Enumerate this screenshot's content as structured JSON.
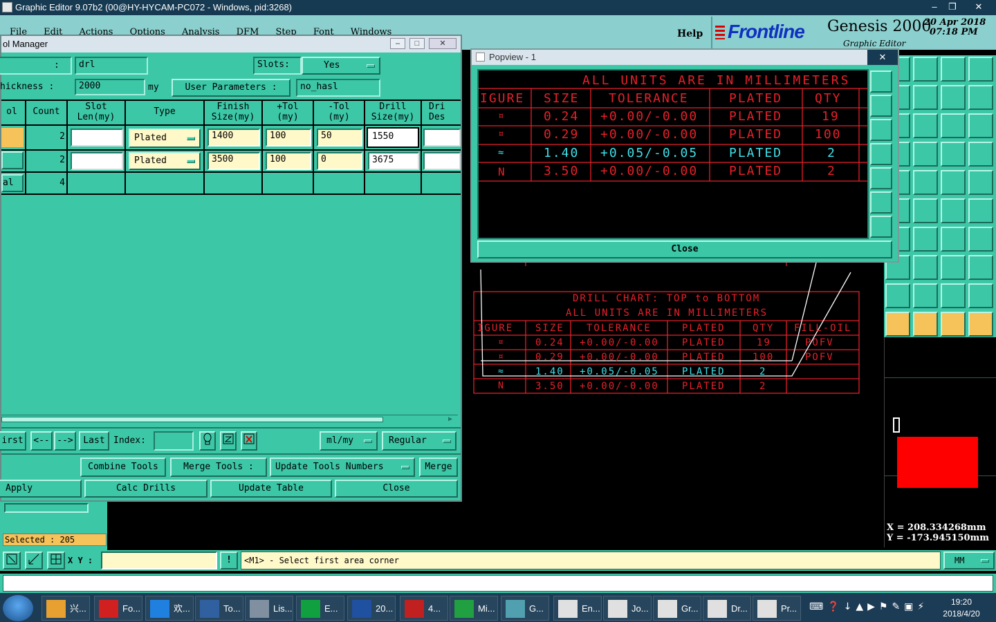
{
  "window": {
    "title": "Graphic Editor 9.07b2 (00@HY-HYCAM-PC072 - Windows, pid:3268)",
    "min": "–",
    "max": "❐",
    "close": "✕"
  },
  "menu": [
    "File",
    "Edit",
    "Actions",
    "Options",
    "Analysis",
    "DFM",
    "Step",
    "Font",
    "Windows"
  ],
  "help": "Help",
  "brand": {
    "logo": "Frontline",
    "product": "Genesis 2000",
    "subtitle": "Graphic Editor",
    "date": "20 Apr 2018",
    "time": "07:18 PM"
  },
  "tool_manager": {
    "title": "ol Manager",
    "colon": ":",
    "layer": "drl",
    "slots_label": "Slots:",
    "slots_value": "Yes",
    "thickness_label": "hickness :",
    "thickness_value": "2000",
    "thickness_unit": "my",
    "user_params_label": "User Parameters :",
    "user_params_value": "no_hasl",
    "columns": [
      "ol",
      "Count",
      "Slot\nLen(my)",
      "Type",
      "Finish\nSize(my)",
      "+Tol\n(my)",
      "-Tol\n(my)",
      "Drill\nSize(my)",
      "Dri\nDes"
    ],
    "rows": [
      {
        "count": "2",
        "type": "Plated",
        "finish": "1400",
        "ptol": "100",
        "ntol": "50",
        "drill": "1550"
      },
      {
        "count": "2",
        "type": "Plated",
        "finish": "3500",
        "ptol": "100",
        "ntol": "0",
        "drill": "3675"
      }
    ],
    "total_label": "al",
    "total_count": "4",
    "nav": {
      "first": "irst",
      "prev": "<--",
      "next": "-->",
      "last": "Last",
      "index": "Index:",
      "units": "ml/my",
      "mode": "Regular"
    },
    "actions": {
      "combine": "Combine Tools",
      "merge_tools": "Merge Tools :",
      "update_numbers": "Update Tools Numbers",
      "merge": "Merge"
    },
    "bottom": {
      "apply": "Apply",
      "calc": "Calc Drills",
      "update": "Update Table",
      "close": "Close"
    }
  },
  "popview": {
    "title": "Popview - 1",
    "heading": "ALL UNITS ARE IN MILLIMETERS",
    "columns": [
      "IGURE",
      "SIZE",
      "TOLERANCE",
      "PLATED",
      "QTY"
    ],
    "rows": [
      {
        "size": "0.24",
        "tol": "+0.00/-0.00",
        "plated": "PLATED",
        "qty": "19",
        "symbol": "¤"
      },
      {
        "size": "0.29",
        "tol": "+0.00/-0.00",
        "plated": "PLATED",
        "qty": "100",
        "symbol": "¤"
      },
      {
        "size": "1.40",
        "tol": "+0.05/-0.05",
        "plated": "PLATED",
        "qty": "2",
        "symbol": "≈"
      },
      {
        "size": "3.50",
        "tol": "+0.00/-0.00",
        "plated": "PLATED",
        "qty": "2",
        "symbol": "N"
      }
    ],
    "close": "Close"
  },
  "chart": {
    "title": "DRILL CHART: TOP to BOTTOM",
    "heading": "ALL UNITS ARE IN MILLIMETERS",
    "columns": [
      "IGURE",
      "SIZE",
      "TOLERANCE",
      "PLATED",
      "QTY",
      "FILL-OIL"
    ],
    "rows": [
      {
        "size": "0.24",
        "tol": "+0.00/-0.00",
        "plated": "PLATED",
        "qty": "19",
        "fill": "POFV"
      },
      {
        "size": "0.29",
        "tol": "+0.00/-0.00",
        "plated": "PLATED",
        "qty": "100",
        "fill": "POFV"
      },
      {
        "size": "1.40",
        "tol": "+0.05/-0.05",
        "plated": "PLATED",
        "qty": "2",
        "fill": ""
      },
      {
        "size": "3.50",
        "tol": "+0.00/-0.00",
        "plated": "PLATED",
        "qty": "2",
        "fill": ""
      }
    ]
  },
  "coords": {
    "x": "X = 208.334268mm",
    "y": "Y = -173.945150mm"
  },
  "selected": "Selected : 205",
  "status": {
    "xy_label": "X Y :",
    "message": "<M1> - Select first area corner",
    "units": "MM"
  },
  "taskbar": {
    "items": [
      "兴...",
      "Fo...",
      "欢...",
      "To...",
      "Lis...",
      "E...",
      "20...",
      "4...",
      "Mi...",
      "G...",
      "En...",
      "Jo...",
      "Gr...",
      "Dr...",
      "Pr..."
    ],
    "time": "19:20",
    "date": "2018/4/20"
  },
  "colors": {
    "chart_red": "#e8202a",
    "chart_cyan": "#40e0e8",
    "panel": "#3cc7a7",
    "highlight": "#f6c35a",
    "canvas_red": "#ff0000"
  }
}
